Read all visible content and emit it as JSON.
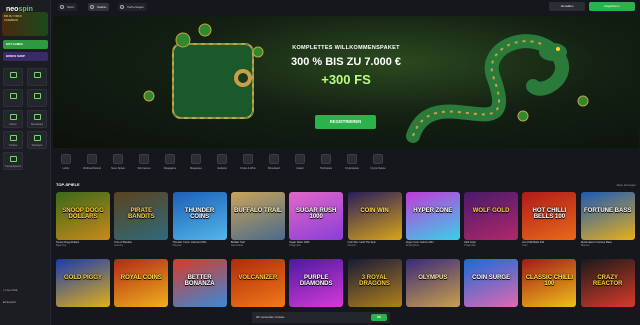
{
  "brand": {
    "name_a": "neo",
    "name_b": "spin",
    "accent": "#29b34a"
  },
  "sidebar": {
    "promo_line1": "BIS ZU 7.000 €",
    "promo_line2": "CASHBACK",
    "hot_button": "HOT GAMES",
    "bonus_button": "BONUS SHOP",
    "tiles": [
      "",
      "",
      "",
      "",
      "Kasino",
      "Sportwetten",
      "Turniere",
      "Werbegen",
      "Treueprogramm"
    ],
    "live_chat": "Live Chat",
    "language": "Deutsch"
  },
  "header": {
    "tabs": [
      {
        "label": "Sport",
        "active": false
      },
      {
        "label": "Casino",
        "active": true
      },
      {
        "label": "Vorhersagen",
        "active": false
      }
    ],
    "login": "Anmelden",
    "register": "Registrieren"
  },
  "hero": {
    "line1": "KOMPLETTES WILLKOMMENSPAKET",
    "line2": "300 % BIS ZU 7.000 €",
    "line3": "+300 FS",
    "cta": "REGISTRIEREN",
    "slides": 4
  },
  "categories": [
    "Lobby",
    "Weihnachtsland",
    "Neue Spiele",
    "Slot Games",
    "Megagame",
    "Megaways",
    "Jackpots",
    "Drops & Wins",
    "Bonuskauf",
    "Instant",
    "Tischspiele",
    "Kryptospiele",
    "Crypto Spiele"
  ],
  "section": {
    "title": "TOP-SPIELE",
    "all": "Alles anzeigen"
  },
  "games_row1": [
    {
      "art": "SNOOP DOGG DOLLARS",
      "name": "Snoop Dogg Dollars",
      "provider": "Bgaming",
      "c1": "#3b6a1a",
      "c2": "#c98a1a",
      "tc": "#ffd23a"
    },
    {
      "art": "PIRATE BANDITS",
      "name": "Pots of Bandits",
      "provider": "Gamzix",
      "c1": "#5a4320",
      "c2": "#2f6a7a",
      "tc": "#ffd23a"
    },
    {
      "art": "THUNDER COINS",
      "name": "Thunder Coins: Hold and Win",
      "provider": "Playson",
      "c1": "#1d5fb8",
      "c2": "#52b7e8",
      "tc": "#ffffff"
    },
    {
      "art": "BUFFALO TRAIL",
      "name": "Buffalo Trail",
      "provider": "Gamebeat",
      "c1": "#c9a35a",
      "c2": "#4a6b8a",
      "tc": "#fff2c0"
    },
    {
      "art": "SUGAR RUSH 1000",
      "name": "Sugar Rush 1000",
      "provider": "Pragmatic",
      "c1": "#e267c8",
      "c2": "#8a3ed8",
      "tc": "#ffffff"
    },
    {
      "art": "COIN WIN",
      "name": "Coin Win: Hold The Spin",
      "provider": "Gamzix",
      "c1": "#2a1d5a",
      "c2": "#d8a51a",
      "tc": "#ffe04a"
    },
    {
      "art": "HYPER ZONE",
      "name": "Hyper Coin: Hold to Win",
      "provider": "Endorphina",
      "c1": "#c23ad8",
      "c2": "#3ad0e8",
      "tc": "#ffffff"
    },
    {
      "art": "WOLF GOLD",
      "name": "Wolf Gold",
      "provider": "Pragmatic",
      "c1": "#4a1a6a",
      "c2": "#b0286a",
      "tc": "#ffd23a"
    },
    {
      "art": "HOT CHILLI BELLS 100",
      "name": "Hot Chilli Bells 100",
      "provider": "Fazi",
      "c1": "#b01a1a",
      "c2": "#e86a1a",
      "tc": "#ffffff"
    },
    {
      "art": "FORTUNE BASS",
      "name": "Duckmaker's Fortune Bass",
      "provider": "Playson",
      "c1": "#1a5ab8",
      "c2": "#e8b01a",
      "tc": "#ffffff"
    }
  ],
  "games_row2": [
    {
      "art": "GOLD PIGGY",
      "name": "3x3 Power Piggy: Hold The Spin",
      "provider": "Gamzix",
      "c1": "#1a3ab0",
      "c2": "#e0b01a",
      "tc": "#ffd23a"
    },
    {
      "art": "ROYAL COINS",
      "name": "Royal Coins: Hold & Win",
      "provider": "Endorphina",
      "c1": "#b02a1a",
      "c2": "#f0b01a",
      "tc": "#ffe04a"
    },
    {
      "art": "BETTER BONANZA",
      "name": "Better Bonanza",
      "provider": "Gamebeat",
      "c1": "#d83a2a",
      "c2": "#3a8ad8",
      "tc": "#ffffff"
    },
    {
      "art": "VOLCANIZER",
      "name": "Volcanizer",
      "provider": "Evoplay",
      "c1": "#b02a0a",
      "c2": "#f07a1a",
      "tc": "#ffd23a"
    },
    {
      "art": "PURPLE DIAMONDS",
      "name": "Crystal Diamonds",
      "provider": "Gamzix",
      "c1": "#4a1aa0",
      "c2": "#d83ad8",
      "tc": "#ffffff"
    },
    {
      "art": "3 ROYAL DRAGONS",
      "name": "3 Royal Dragons",
      "provider": "Gamzix",
      "c1": "#1a1a3a",
      "c2": "#b0801a",
      "tc": "#ffd23a"
    },
    {
      "art": "OLYMPUS",
      "name": "Gates of Olympus",
      "provider": "Pragmatic",
      "c1": "#3a2a7a",
      "c2": "#c9a04a",
      "tc": "#ffe8a0"
    },
    {
      "art": "COIN SURGE",
      "name": "Coin Surge",
      "provider": "Playson",
      "c1": "#1a6ad8",
      "c2": "#e06ab0",
      "tc": "#ffffff"
    },
    {
      "art": "CLASSIC CHILLI 100",
      "name": "Classic Chilli 100",
      "provider": "Fazi",
      "c1": "#a01a1a",
      "c2": "#f0c01a",
      "tc": "#ffe04a"
    },
    {
      "art": "CRAZY REACTOR",
      "name": "Crazy Reactor",
      "provider": "Pragmatic",
      "c1": "#1a1a1a",
      "c2": "#d83a2a",
      "tc": "#ffd23a"
    }
  ],
  "cookie": {
    "text": "Wir verwenden Cookies",
    "ok": "OK"
  }
}
